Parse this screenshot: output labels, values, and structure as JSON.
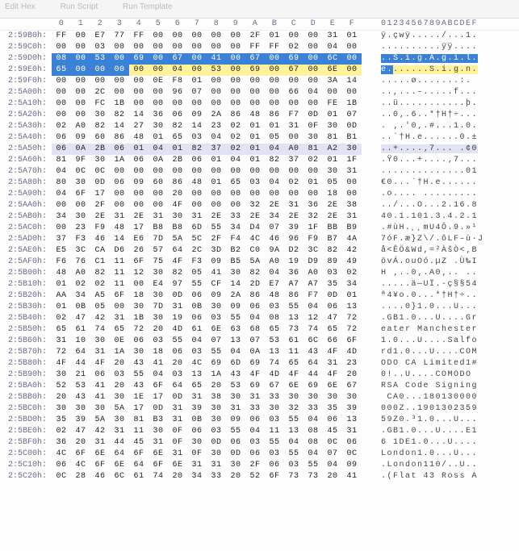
{
  "toolbar": {
    "items": [
      "Edit Hex",
      "Run Script",
      "Run Template"
    ]
  },
  "header": {
    "cols": [
      "0",
      "1",
      "2",
      "3",
      "4",
      "5",
      "6",
      "7",
      "8",
      "9",
      "A",
      "B",
      "C",
      "D",
      "E",
      "F"
    ],
    "ascii": "0123456789ABCDEF"
  },
  "rows": [
    {
      "a": "2:59B0h:",
      "h": [
        "FF",
        "00",
        "E7",
        "77",
        "FF",
        "00",
        "00",
        "00",
        "00",
        "00",
        "2F",
        "01",
        "00",
        "00",
        "31",
        "01"
      ],
      "s": "ÿ.çwÿ...../...1."
    },
    {
      "a": "2:59C0h:",
      "h": [
        "00",
        "00",
        "03",
        "00",
        "00",
        "00",
        "00",
        "00",
        "00",
        "00",
        "FF",
        "FF",
        "02",
        "00",
        "04",
        "00"
      ],
      "s": "..........ÿÿ...."
    },
    {
      "a": "2:59D0h:",
      "h": [
        "08",
        "00",
        "53",
        "00",
        "69",
        "00",
        "67",
        "00",
        "41",
        "00",
        "67",
        "00",
        "69",
        "00",
        "6C",
        "00"
      ],
      "s": "..S.i.g.A.g.i.l.",
      "hl": "sel",
      "ahl": "sel"
    },
    {
      "a": "2:59E0h:",
      "h": [
        "65",
        "00",
        "00",
        "00",
        "00",
        "00",
        "04",
        "00",
        "53",
        "00",
        "69",
        "00",
        "67",
        "00",
        "6E",
        "00"
      ],
      "s": "e.......S.i.g.n.",
      "hl": "mix",
      "ahl": "mix"
    },
    {
      "a": "2:59F0h:",
      "h": [
        "00",
        "00",
        "00",
        "00",
        "00",
        "0E",
        "F8",
        "01",
        "00",
        "00",
        "00",
        "00",
        "00",
        "00",
        "3A",
        "14"
      ],
      "s": ".....ø.......:."
    },
    {
      "a": "2:5A00h:",
      "h": [
        "00",
        "00",
        "2C",
        "00",
        "00",
        "00",
        "96",
        "07",
        "00",
        "00",
        "00",
        "00",
        "66",
        "04",
        "00",
        "00"
      ],
      "s": "..,...–.....f..."
    },
    {
      "a": "2:5A10h:",
      "h": [
        "00",
        "00",
        "FC",
        "1B",
        "00",
        "00",
        "00",
        "00",
        "00",
        "00",
        "00",
        "00",
        "00",
        "00",
        "FE",
        "1B"
      ],
      "s": "..ü...........þ."
    },
    {
      "a": "2:5A20h:",
      "h": [
        "00",
        "00",
        "30",
        "82",
        "14",
        "36",
        "06",
        "09",
        "2A",
        "86",
        "48",
        "86",
        "F7",
        "0D",
        "01",
        "07"
      ],
      "s": "..0‚.6..*†H†÷..."
    },
    {
      "a": "2:5A30h:",
      "h": [
        "02",
        "A0",
        "82",
        "14",
        "27",
        "30",
        "82",
        "14",
        "23",
        "02",
        "01",
        "01",
        "31",
        "0F",
        "30",
        "0D"
      ],
      "s": ". ‚.'0‚.#...1.0."
    },
    {
      "a": "2:5A40h:",
      "h": [
        "06",
        "09",
        "60",
        "86",
        "48",
        "01",
        "65",
        "03",
        "04",
        "02",
        "01",
        "05",
        "00",
        "30",
        "81",
        "B1"
      ],
      "s": "..`†H.e......0.±"
    },
    {
      "a": "2:5A50h:",
      "h": [
        "06",
        "0A",
        "2B",
        "06",
        "01",
        "04",
        "01",
        "82",
        "37",
        "02",
        "01",
        "04",
        "A0",
        "81",
        "A2",
        "30"
      ],
      "s": "..+....‚7... .¢0",
      "hl": "lav",
      "ahl": "lav"
    },
    {
      "a": "2:5A60h:",
      "h": [
        "81",
        "9F",
        "30",
        "1A",
        "06",
        "0A",
        "2B",
        "06",
        "01",
        "04",
        "01",
        "82",
        "37",
        "02",
        "01",
        "1F"
      ],
      "s": ".Ÿ0...+....‚7..."
    },
    {
      "a": "2:5A70h:",
      "h": [
        "04",
        "0C",
        "0C",
        "00",
        "00",
        "00",
        "00",
        "00",
        "00",
        "00",
        "00",
        "00",
        "00",
        "00",
        "30",
        "31"
      ],
      "s": "..............01"
    },
    {
      "a": "2:5A80h:",
      "h": [
        "80",
        "30",
        "0D",
        "06",
        "09",
        "60",
        "86",
        "48",
        "01",
        "65",
        "03",
        "04",
        "02",
        "01",
        "05",
        "00"
      ],
      "s": "€0...`†H.e......"
    },
    {
      "a": "2:5A90h:",
      "h": [
        "04",
        "6F",
        "17",
        "00",
        "00",
        "00",
        "20",
        "00",
        "00",
        "00",
        "00",
        "00",
        "00",
        "00",
        "18",
        "00"
      ],
      "s": ".o.... ........."
    },
    {
      "a": "2:5AA0h:",
      "h": [
        "00",
        "00",
        "2F",
        "00",
        "00",
        "00",
        "4F",
        "00",
        "00",
        "00",
        "32",
        "2E",
        "31",
        "36",
        "2E",
        "38"
      ],
      "s": "../...O...2.16.8"
    },
    {
      "a": "2:5AB0h:",
      "h": [
        "34",
        "30",
        "2E",
        "31",
        "2E",
        "31",
        "30",
        "31",
        "2E",
        "33",
        "2E",
        "34",
        "2E",
        "32",
        "2E",
        "31"
      ],
      "s": "40.1.101.3.4.2.1"
    },
    {
      "a": "2:5AC0h:",
      "h": [
        "00",
        "23",
        "F9",
        "48",
        "17",
        "B8",
        "B8",
        "6D",
        "55",
        "34",
        "D4",
        "07",
        "39",
        "1F",
        "BB",
        "B9"
      ],
      "s": ".#ùH.¸¸mU4Ô.9.»¹"
    },
    {
      "a": "2:5AD0h:",
      "h": [
        "37",
        "F3",
        "46",
        "14",
        "E6",
        "7D",
        "5A",
        "5C",
        "2F",
        "F4",
        "4C",
        "46",
        "96",
        "F9",
        "B7",
        "4A"
      ],
      "s": "7óF.æ}Z\\/.ôLF–ù·J"
    },
    {
      "a": "2:5AE0h:",
      "h": [
        "E5",
        "3C",
        "CA",
        "D6",
        "26",
        "57",
        "64",
        "2C",
        "3D",
        "B2",
        "C0",
        "9A",
        "D2",
        "3C",
        "82",
        "42"
      ],
      "s": "å<ÊÖ&Wd,=²ÀšÒ<‚B"
    },
    {
      "a": "2:5AF0h:",
      "h": [
        "F6",
        "76",
        "C1",
        "11",
        "6F",
        "75",
        "4F",
        "F3",
        "09",
        "B5",
        "5A",
        "A0",
        "19",
        "D9",
        "89",
        "49"
      ],
      "s": "övÁ.ouOó.µZ .Ù‰I"
    },
    {
      "a": "2:5B00h:",
      "h": [
        "48",
        "A0",
        "82",
        "11",
        "12",
        "30",
        "82",
        "05",
        "41",
        "30",
        "82",
        "04",
        "36",
        "A0",
        "03",
        "02"
      ],
      "s": "H ‚..0‚.A0‚.. .."
    },
    {
      "a": "2:5B10h:",
      "h": [
        "01",
        "02",
        "02",
        "11",
        "00",
        "E4",
        "97",
        "55",
        "CF",
        "14",
        "2D",
        "E7",
        "A7",
        "A7",
        "35",
        "34"
      ],
      "s": ".....ä—UÏ.-ç§§54"
    },
    {
      "a": "2:5B20h:",
      "h": [
        "AA",
        "34",
        "A5",
        "6F",
        "18",
        "30",
        "0D",
        "06",
        "09",
        "2A",
        "86",
        "48",
        "86",
        "F7",
        "0D",
        "01"
      ],
      "s": "ª4¥o.0...*†H†÷.."
    },
    {
      "a": "2:5B30h:",
      "h": [
        "01",
        "0B",
        "05",
        "00",
        "30",
        "7D",
        "31",
        "0B",
        "30",
        "09",
        "06",
        "03",
        "55",
        "04",
        "06",
        "13"
      ],
      "s": "....0}1.0...U..."
    },
    {
      "a": "2:5B40h:",
      "h": [
        "02",
        "47",
        "42",
        "31",
        "1B",
        "30",
        "19",
        "06",
        "03",
        "55",
        "04",
        "08",
        "13",
        "12",
        "47",
        "72"
      ],
      "s": ".GB1.0...U....Gr"
    },
    {
      "a": "2:5B50h:",
      "h": [
        "65",
        "61",
        "74",
        "65",
        "72",
        "20",
        "4D",
        "61",
        "6E",
        "63",
        "68",
        "65",
        "73",
        "74",
        "65",
        "72"
      ],
      "s": "eater Manchester"
    },
    {
      "a": "2:5B60h:",
      "h": [
        "31",
        "10",
        "30",
        "0E",
        "06",
        "03",
        "55",
        "04",
        "07",
        "13",
        "07",
        "53",
        "61",
        "6C",
        "66",
        "6F"
      ],
      "s": "1.0...U....Salfo"
    },
    {
      "a": "2:5B70h:",
      "h": [
        "72",
        "64",
        "31",
        "1A",
        "30",
        "18",
        "06",
        "03",
        "55",
        "04",
        "0A",
        "13",
        "11",
        "43",
        "4F",
        "4D"
      ],
      "s": "rd1.0...U....COM"
    },
    {
      "a": "2:5B80h:",
      "h": [
        "4F",
        "44",
        "4F",
        "20",
        "43",
        "41",
        "20",
        "4C",
        "69",
        "6D",
        "69",
        "74",
        "65",
        "64",
        "31",
        "23"
      ],
      "s": "ODO CA Limited1#"
    },
    {
      "a": "2:5B90h:",
      "h": [
        "30",
        "21",
        "06",
        "03",
        "55",
        "04",
        "03",
        "13",
        "1A",
        "43",
        "4F",
        "4D",
        "4F",
        "44",
        "4F",
        "20"
      ],
      "s": "0!..U....COMODO "
    },
    {
      "a": "2:5BA0h:",
      "h": [
        "52",
        "53",
        "41",
        "20",
        "43",
        "6F",
        "64",
        "65",
        "20",
        "53",
        "69",
        "67",
        "6E",
        "69",
        "6E",
        "67"
      ],
      "s": "RSA Code Signing"
    },
    {
      "a": "2:5BB0h:",
      "h": [
        "20",
        "43",
        "41",
        "30",
        "1E",
        "17",
        "0D",
        "31",
        "38",
        "30",
        "31",
        "33",
        "30",
        "30",
        "30",
        "30"
      ],
      "s": " CA0...180130000"
    },
    {
      "a": "2:5BC0h:",
      "h": [
        "30",
        "30",
        "30",
        "5A",
        "17",
        "0D",
        "31",
        "39",
        "30",
        "31",
        "33",
        "30",
        "32",
        "33",
        "35",
        "39"
      ],
      "s": "000Z..1901302359"
    },
    {
      "a": "2:5BD0h:",
      "h": [
        "35",
        "39",
        "5A",
        "30",
        "81",
        "B3",
        "31",
        "0B",
        "30",
        "09",
        "06",
        "03",
        "55",
        "04",
        "06",
        "13"
      ],
      "s": "59Z0.³1.0...U..."
    },
    {
      "a": "2:5BE0h:",
      "h": [
        "02",
        "47",
        "42",
        "31",
        "11",
        "30",
        "0F",
        "06",
        "03",
        "55",
        "04",
        "11",
        "13",
        "08",
        "45",
        "31"
      ],
      "s": ".GB1.0...U....E1"
    },
    {
      "a": "2:5BF0h:",
      "h": [
        "36",
        "20",
        "31",
        "44",
        "45",
        "31",
        "0F",
        "30",
        "0D",
        "06",
        "03",
        "55",
        "04",
        "08",
        "0C",
        "06"
      ],
      "s": "6 1DE1.0...U...."
    },
    {
      "a": "2:5C00h:",
      "h": [
        "4C",
        "6F",
        "6E",
        "64",
        "6F",
        "6E",
        "31",
        "0F",
        "30",
        "0D",
        "06",
        "03",
        "55",
        "04",
        "07",
        "0C"
      ],
      "s": "London1.0...U..."
    },
    {
      "a": "2:5C10h:",
      "h": [
        "06",
        "4C",
        "6F",
        "6E",
        "64",
        "6F",
        "6E",
        "31",
        "31",
        "30",
        "2F",
        "06",
        "03",
        "55",
        "04",
        "09"
      ],
      "s": ".London110/..U.."
    },
    {
      "a": "2:5C20h:",
      "h": [
        "0C",
        "28",
        "46",
        "6C",
        "61",
        "74",
        "20",
        "34",
        "33",
        "20",
        "52",
        "6F",
        "73",
        "73",
        "20",
        "41"
      ],
      "s": ".(Flat 43 Ross A"
    }
  ]
}
